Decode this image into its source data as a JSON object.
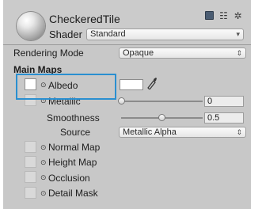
{
  "header": {
    "material_name": "CheckeredTile",
    "shader_label": "Shader",
    "shader_value": "Standard",
    "icons": [
      "help-book-icon",
      "preset-settings-icon",
      "gear-icon"
    ]
  },
  "rendering_mode": {
    "label": "Rendering Mode",
    "value": "Opaque"
  },
  "main_maps": {
    "heading": "Main Maps",
    "albedo": {
      "label": "Albedo",
      "color": "#ffffff"
    },
    "metallic": {
      "label": "Metallic",
      "value": "0",
      "slider_fraction": 0.0
    },
    "smoothness": {
      "label": "Smoothness",
      "value": "0.5",
      "slider_fraction": 0.5
    },
    "source": {
      "label": "Source",
      "value": "Metallic Alpha"
    },
    "normal_map": {
      "label": "Normal Map"
    },
    "height_map": {
      "label": "Height Map"
    },
    "occlusion": {
      "label": "Occlusion"
    },
    "detail_mask": {
      "label": "Detail Mask"
    }
  },
  "colors": {
    "panel_bg": "#c8c8c8",
    "highlight": "#2a8fd0"
  }
}
